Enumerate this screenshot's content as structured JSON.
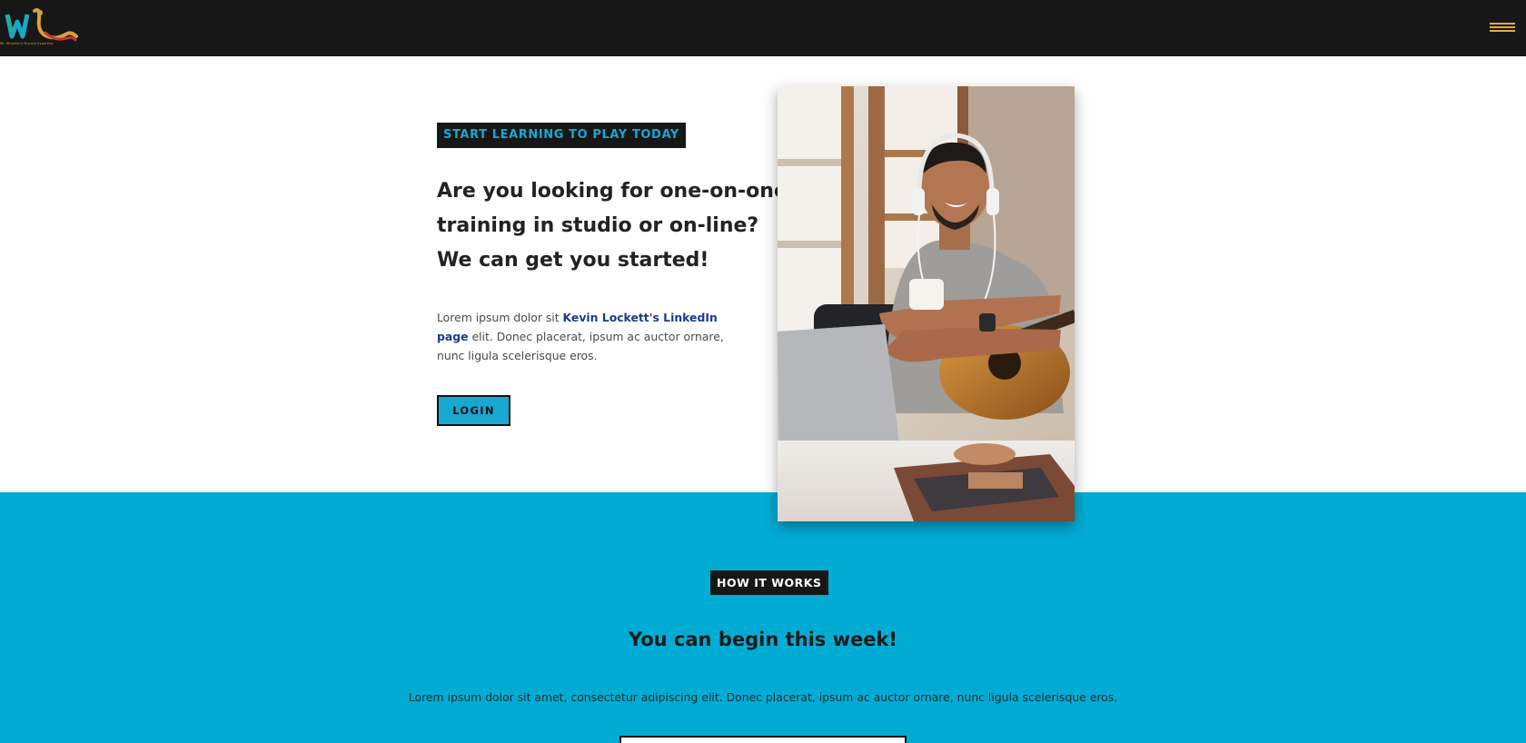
{
  "brand": {
    "logo_alt": "WL logo",
    "logo_caption": "Mr. Wheeler's Musical Expertise",
    "colors": {
      "dark": "#171717",
      "accent_blue": "#00acd4",
      "gold": "#e0b138"
    }
  },
  "nav": {
    "menu_icon": "hamburger-menu-icon"
  },
  "hero": {
    "eyebrow": "START LEARNING TO PLAY TODAY",
    "headline_line1": "Are you looking for one-on-one",
    "headline_line2": "training in studio or on-line?",
    "headline_line3": "We can get you started!",
    "body_before": "Lorem ipsum dolor sit ",
    "body_link": "Kevin Lockett's LinkedIn page",
    "body_after": " elit. Donec placerat, ipsum ac auctor ornare, nunc ligula scelerisque eros.",
    "login_label": "LOGIN",
    "photo_alt": "Smiling man wearing headphones with a guitar and a coffee cup"
  },
  "how": {
    "tag": "HOW IT WORKS",
    "title": "You can begin this week!",
    "body": "Lorem ipsum dolor sit amet, consectetur adipiscing elit. Donec placerat, ipsum ac auctor ornare, nunc ligula scelerisque eros."
  }
}
